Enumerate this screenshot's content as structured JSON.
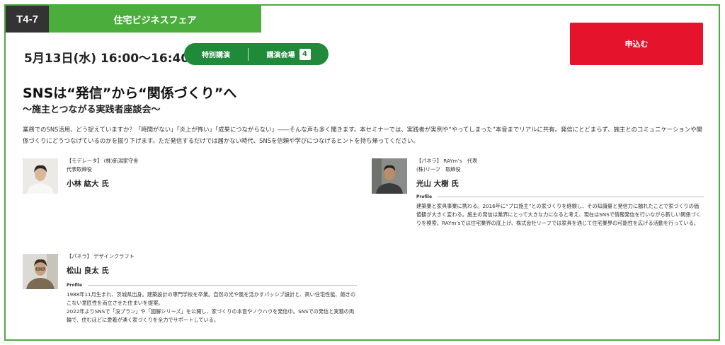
{
  "session": {
    "code": "T4-7",
    "fair": "住宅ビジネスフェア",
    "datetime": "5月13日(水) 16:00〜16:40",
    "type": "特別講演",
    "hall_label": "講演会場",
    "hall_number": "4",
    "apply_label": "申込む"
  },
  "seminar": {
    "title": "SNSは“発信”から“関係づくり”へ",
    "subtitle": "〜施主とつながる実践者座談会〜",
    "description": "業務でのSNS活用、どう捉えていますか？「時間がない」「炎上が怖い」「成果につながらない」――そんな声も多く聞きます。本セミナーでは、実践者が実例や“やってしまった”本音までリアルに共有。発信にとどまらず、施主とのコミュニケーションや関係づくりにどうつなげているのかを掘り下げます。ただ発信するだけでは届かない時代、SNSを信頼や学びにつなげるヒントを持ち帰ってください。"
  },
  "speakers": [
    {
      "role1": "【モデレータ】 (株)新潟家守舎",
      "role2": "代表取締役",
      "name": "小林 紘大 氏"
    },
    {
      "role1": "【パネラ】 RAYm’s　代表",
      "role2": "(株)リーフ　取締役",
      "name": "光山 大樹 氏",
      "profile_label": "Profile",
      "bio": "建築業と家具事業に携わる。2016年に“プロ施主”との家づくりを経験し、その知識量と発信力に触れたことで家づくりの価値観が大きく変わる。施主の発信は業界にとって大きな力になると考え、現在はSNSで情報発信を行いながら新しい関係づくりを模索。RAYm’sでは住宅業界の底上げ、株式会社リーフでは家具を通じて住宅業界の可能性を広げる活動を行っている。"
    },
    {
      "role1": "【パネラ】 デザインクラフト",
      "name": "松山 良太 氏",
      "profile_label": "Profile",
      "bio1": "1988年11月生まれ、茨城県出身。建築設計の専門学校を卒業。自然の光や風を活かすパッシブ設計と、高い住宅性能、飽きのこない意匠性を両立させた住まいを提案。",
      "bio2": "2022年よりSNSで「没プラン」や「図解シリーズ」を公開し、家づくりの本音やノウハウを発信中。SNSでの発信と実務の両輪で、住むほどに愛着が湧く家づくりを全力でサポートしている。"
    }
  ],
  "colors": {
    "green": "#4aad3c",
    "dark_green": "#1f8a3a",
    "red": "#e5132b",
    "dark": "#333333"
  }
}
